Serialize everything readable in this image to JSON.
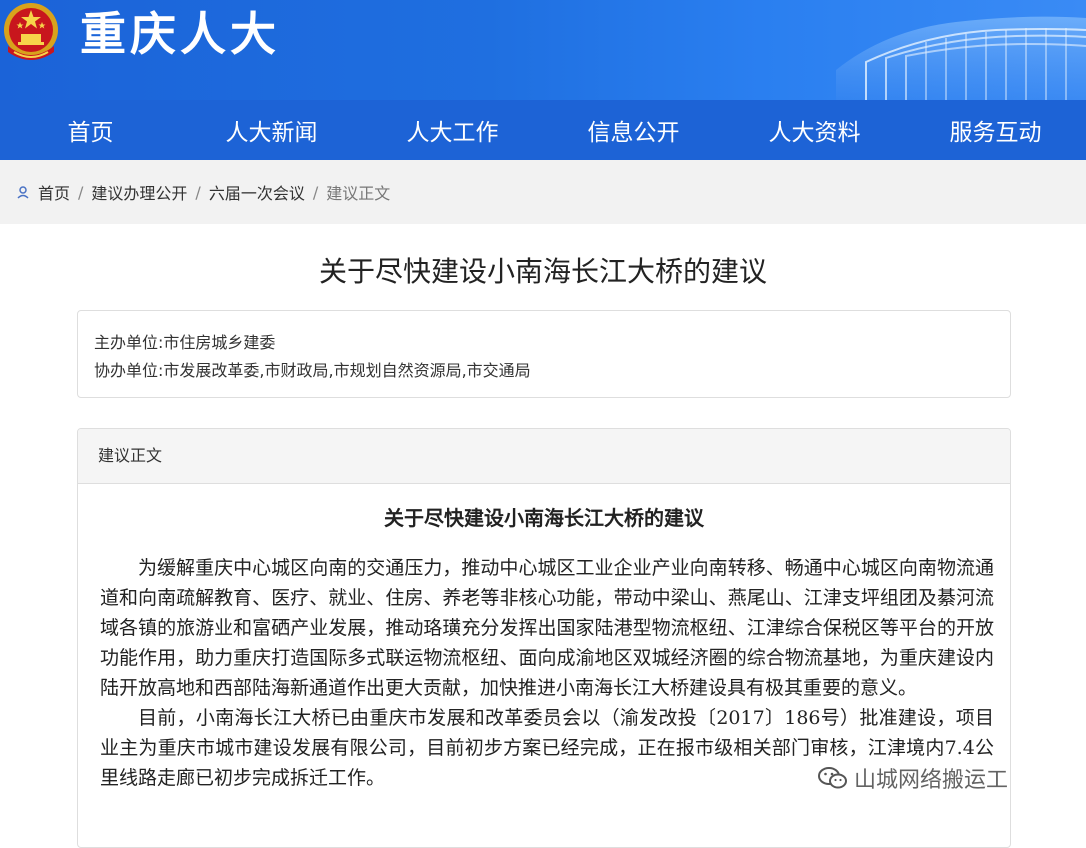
{
  "header": {
    "site_title": "重庆人大"
  },
  "nav": {
    "items": [
      "首页",
      "人大新闻",
      "人大工作",
      "信息公开",
      "人大资料",
      "服务互动"
    ]
  },
  "breadcrumb": {
    "items": [
      "首页",
      "建议办理公开",
      "六届一次会议",
      "建议正文"
    ],
    "separator": "/"
  },
  "page": {
    "title": "关于尽快建设小南海长江大桥的建议"
  },
  "info": {
    "lead_label": "主办单位:",
    "lead_value": "市住房城乡建委",
    "assist_label": "协办单位:",
    "assist_value": "市发展改革委,市财政局,市规划自然资源局,市交通局"
  },
  "panel": {
    "header": "建议正文",
    "doc_title": "关于尽快建设小南海长江大桥的建议",
    "paragraphs": [
      "为缓解重庆中心城区向南的交通压力，推动中心城区工业企业产业向南转移、畅通中心城区向南物流通道和向南疏解教育、医疗、就业、住房、养老等非核心功能，带动中梁山、燕尾山、江津支坪组团及綦河流域各镇的旅游业和富硒产业发展，推动珞璜充分发挥出国家陆港型物流枢纽、江津综合保税区等平台的开放功能作用，助力重庆打造国际多式联运物流枢纽、面向成渝地区双城经济圈的综合物流基地，为重庆建设内陆开放高地和西部陆海新通道作出更大贡献，加快推进小南海长江大桥建设具有极其重要的意义。",
      "目前，小南海长江大桥已由重庆市发展和改革委员会以（渝发改投〔2017〕186号）批准建设，项目业主为重庆市城市建设发展有限公司，目前初步方案已经完成，正在报市级相关部门审核，江津境内7.4公里线路走廊已初步完成拆迁工作。"
    ]
  },
  "watermark": {
    "text": "山城网络搬运工"
  },
  "colors": {
    "header_blue": "#1f6fe0",
    "nav_blue": "#1d63d6",
    "breadcrumb_bg": "#f2f2f2"
  }
}
